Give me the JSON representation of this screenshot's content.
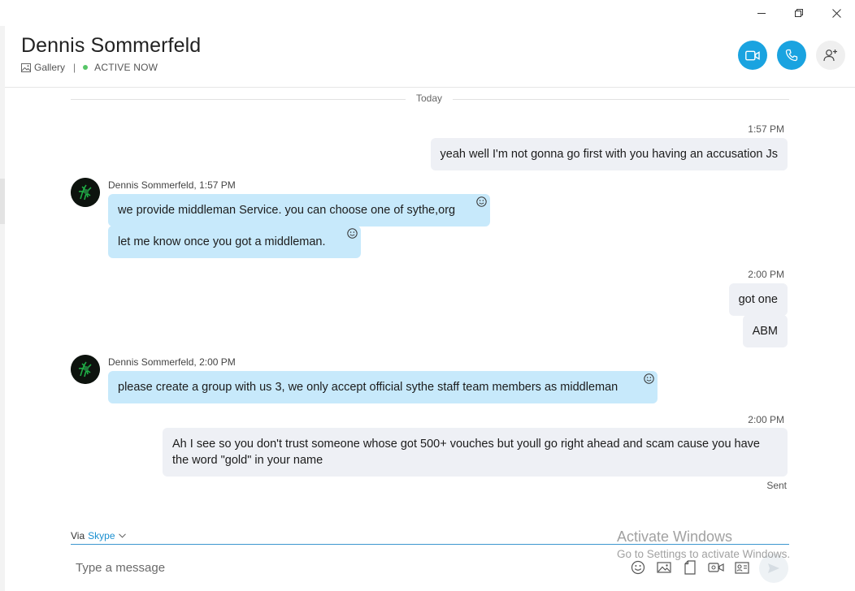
{
  "window": {
    "controls": [
      "minimize",
      "restore",
      "close"
    ]
  },
  "header": {
    "contact_name": "Dennis Sommerfeld",
    "gallery_label": "Gallery",
    "separator": "|",
    "status": "ACTIVE NOW",
    "actions": [
      "video-call",
      "audio-call",
      "add-people"
    ]
  },
  "chat": {
    "day_divider": "Today",
    "messages": [
      {
        "dir": "out",
        "time": "1:57 PM",
        "text": "yeah well I'm not gonna go first with you having an accusation Js"
      },
      {
        "dir": "in",
        "sender": "Dennis Sommerfeld,",
        "time": "1:57 PM",
        "text": "we provide middleman Service. you can choose one of sythe,org"
      },
      {
        "dir": "in",
        "text": "let me know once you got a middleman."
      },
      {
        "dir": "out",
        "time": "2:00 PM",
        "text": "got one"
      },
      {
        "dir": "out",
        "text": "ABM"
      },
      {
        "dir": "in",
        "sender": "Dennis Sommerfeld,",
        "time": "2:00 PM",
        "text": "please create a group with us 3, we only accept official sythe staff team members as middleman"
      },
      {
        "dir": "out",
        "time": "2:00 PM",
        "text": "Ah I see so you don't trust someone whose got 500+ vouches but youll go right ahead and scam cause you have the word \"gold\" in your name"
      }
    ],
    "sent_status": "Sent"
  },
  "composer": {
    "via_label": "Via",
    "via_service": "Skype",
    "placeholder": "Type a message",
    "tools": [
      "emoji-icon",
      "image-icon",
      "file-icon",
      "video-message-icon",
      "contact-card-icon"
    ]
  },
  "watermark": {
    "line1": "Activate Windows",
    "line2": "Go to Settings to activate Windows."
  },
  "colors": {
    "accent": "#1aa3e0",
    "incoming_bubble": "#c7e9fb",
    "outgoing_bubble": "#eef0f5",
    "presence": "#57c567"
  }
}
